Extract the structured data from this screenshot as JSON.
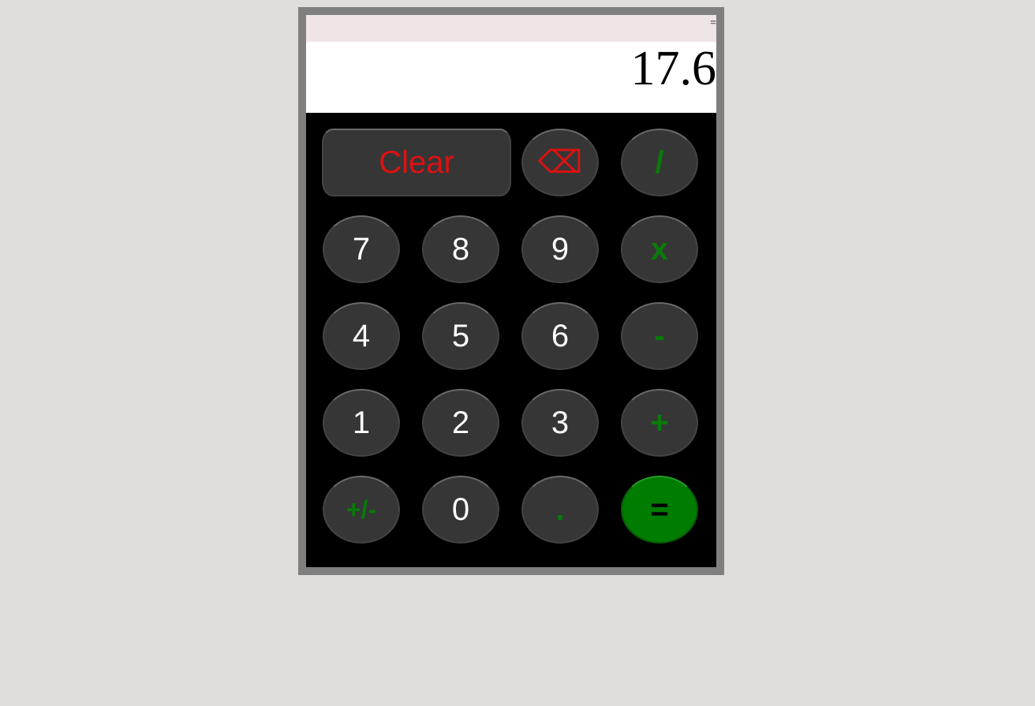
{
  "history": {
    "text": "="
  },
  "display": {
    "value": "17.6"
  },
  "keys": {
    "clear": "Clear",
    "backspace": "⌫",
    "divide": "/",
    "seven": "7",
    "eight": "8",
    "nine": "9",
    "multiply": "x",
    "four": "4",
    "five": "5",
    "six": "6",
    "subtract": "-",
    "one": "1",
    "two": "2",
    "three": "3",
    "add": "+",
    "negate": "+/-",
    "zero": "0",
    "decimal": ".",
    "equals": "="
  },
  "colors": {
    "function_key_text": "#dd1111",
    "operator_key_text": "#0a7a0a",
    "equals_key_background": "#007d00",
    "key_background": "#363636"
  }
}
